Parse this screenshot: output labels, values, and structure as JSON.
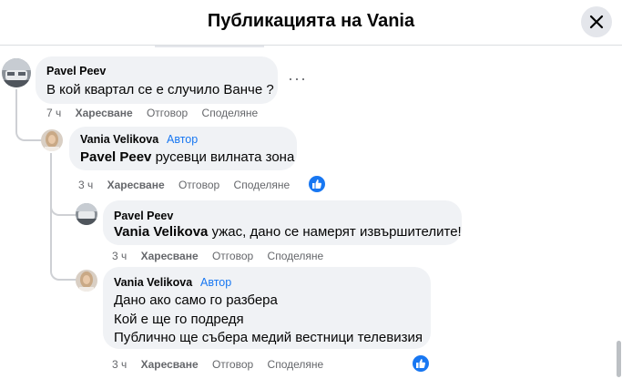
{
  "header": {
    "title": "Публикацията на Vania"
  },
  "comments": [
    {
      "author": "Pavel Peev",
      "text": "В кой квартал се е случило Ванче ?",
      "time": "7 ч",
      "like": "Харесване",
      "reply": "Отговор",
      "share": "Споделяне"
    },
    {
      "author": "Vania Velikova",
      "badge": "Автор",
      "mention": "Pavel Peev",
      "text": " русевци вилната зона",
      "time": "3 ч",
      "like": "Харесване",
      "reply": "Отговор",
      "share": "Споделяне"
    },
    {
      "author": "Pavel Peev",
      "mention": "Vania Velikova",
      "text": " ужас, дано се намерят извършителите!",
      "time": "3 ч",
      "like": "Харесване",
      "reply": "Отговор",
      "share": "Споделяне"
    },
    {
      "author": "Vania Velikova",
      "badge": "Автор",
      "lines": [
        "Дано ако само го разбера",
        "Кой е ще го подредя",
        "Публично ще събера медий вестници телевизия"
      ],
      "time": "3 ч",
      "like": "Харесване",
      "reply": "Отговор",
      "share": "Споделяне"
    }
  ],
  "icons": {
    "close": "close-icon",
    "more": "more-options-icon",
    "like_reaction": "thumbs-up-icon"
  },
  "colors": {
    "accent": "#1877f2",
    "bubble": "#f0f2f5",
    "secondary_text": "#65676b"
  }
}
